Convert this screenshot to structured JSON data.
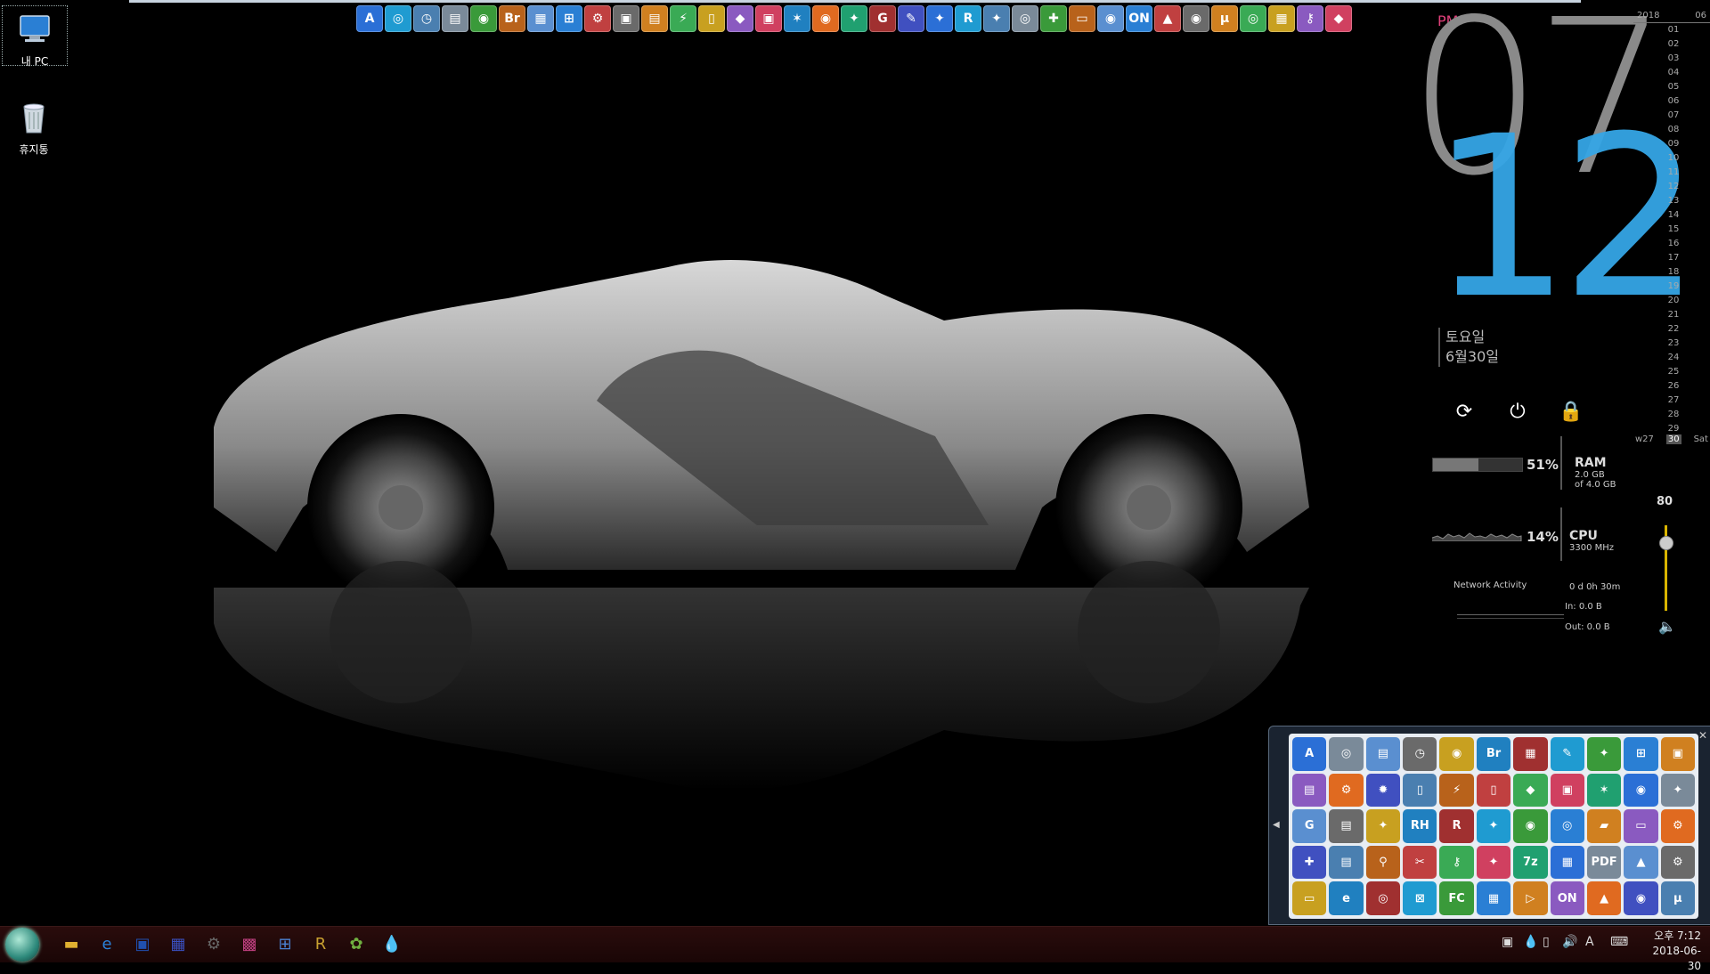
{
  "desktop": {
    "icons": [
      {
        "label": "내 PC",
        "icon": "monitor-icon"
      },
      {
        "label": "휴지통",
        "icon": "recycle-bin-icon"
      }
    ]
  },
  "topdock": {
    "items": [
      "A",
      "◎",
      "◷",
      "▤",
      "◉",
      "Br",
      "▦",
      "⊞",
      "⚙",
      "▣",
      "▤",
      "⚡",
      "▯",
      "◆",
      "▣",
      "✶",
      "◉",
      "✦",
      "G",
      "✎",
      "✦",
      "R",
      "✦",
      "◎",
      "✚",
      "▭",
      "◉",
      "ON",
      "▲",
      "◉",
      "μ",
      "◎",
      "▦",
      "⚷",
      "◆"
    ]
  },
  "clock": {
    "ampm": "PM",
    "hour": "07",
    "minute": "12",
    "weekday": "토요일",
    "date": "6월30일"
  },
  "power": {
    "restart_icon": "restart-icon",
    "shutdown_icon": "power-icon",
    "lock_icon": "lock-icon"
  },
  "ram": {
    "percent": "51%",
    "label": "RAM",
    "used": "2.0 GB",
    "total": "of 4.0 GB",
    "level": 0.51
  },
  "cpu": {
    "percent": "14%",
    "label": "CPU",
    "speed": "3300 MHz",
    "level": 0.14
  },
  "network": {
    "label": "Network Activity",
    "uptime": "0 d 0h 30m",
    "in": "In: 0.0 B",
    "out": "Out: 0.0 B"
  },
  "calendar": {
    "year": "2018",
    "month": "06",
    "days": [
      "01",
      "02",
      "03",
      "04",
      "05",
      "06",
      "07",
      "08",
      "09",
      "10",
      "11",
      "12",
      "13",
      "14",
      "15",
      "16",
      "17",
      "18",
      "19",
      "20",
      "21",
      "22",
      "23",
      "24",
      "25",
      "26",
      "27",
      "28",
      "29"
    ],
    "week": "w27",
    "today": "30",
    "today_name": "Sat"
  },
  "volume": {
    "value": "80",
    "level": 0.8
  },
  "tray_panel": {
    "icons": [
      "A",
      "◎",
      "▤",
      "◷",
      "◉",
      "Br",
      "▦",
      "✎",
      "✦",
      "⊞",
      "▣",
      "▤",
      "⚙",
      "✹",
      "▯",
      "⚡",
      "▯",
      "◆",
      "▣",
      "✶",
      "◉",
      "✦",
      "G",
      "▤",
      "✦",
      "RH",
      "R",
      "✦",
      "◉",
      "◎",
      "▰",
      "▭",
      "⚙",
      "✚",
      "▤",
      "⚲",
      "✂",
      "⚷",
      "✦",
      "7z",
      "▦",
      "PDF",
      "▲",
      "⚙",
      "▭",
      "e",
      "◎",
      "⊠",
      "FC",
      "▦",
      "▷",
      "ON",
      "▲",
      "◉",
      "μ"
    ]
  },
  "taskbar": {
    "items": [
      {
        "icon": "folder-icon",
        "glyph": "▬"
      },
      {
        "icon": "ie-icon",
        "glyph": "e"
      },
      {
        "icon": "floppy-icon",
        "glyph": "▣"
      },
      {
        "icon": "grid-app-icon",
        "glyph": "▦"
      },
      {
        "icon": "gear-app-icon",
        "glyph": "⚙"
      },
      {
        "icon": "color-app-icon",
        "glyph": "▩"
      },
      {
        "icon": "tiles-icon",
        "glyph": "⊞"
      },
      {
        "icon": "r-app-icon",
        "glyph": "R"
      },
      {
        "icon": "leaf-icon",
        "glyph": "✿"
      },
      {
        "icon": "drop-icon",
        "glyph": "💧"
      }
    ],
    "tray": {
      "ime": "A",
      "time": "오후 7:12",
      "date": "2018-06-30"
    }
  }
}
